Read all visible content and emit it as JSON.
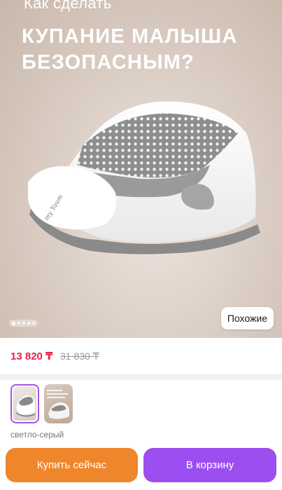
{
  "hero": {
    "title_line1": "Как сделать",
    "title_line2": "КУПАНИЕ МАЛЫША",
    "title_line3": "БЕЗОПАСНЫМ?",
    "brand_logo_text": "my Yaum",
    "similar_button": "Похожие",
    "carousel": {
      "slides": 5,
      "active_index": 0
    }
  },
  "price": {
    "current": "13 820 ₸",
    "old": "31 830 ₸"
  },
  "variants": {
    "items": [
      {
        "name": "светло-серый",
        "selected": true
      },
      {
        "name": "thumbnail-2",
        "selected": false
      }
    ],
    "selected_label": "светло-серый"
  },
  "actions": {
    "buy_now": "Купить сейчас",
    "add_to_cart": "В корзину"
  },
  "colors": {
    "price_accent": "#e6224a",
    "buy_button": "#f0862c",
    "cart_button": "#9b4ff0",
    "selected_border": "#a355e3"
  }
}
